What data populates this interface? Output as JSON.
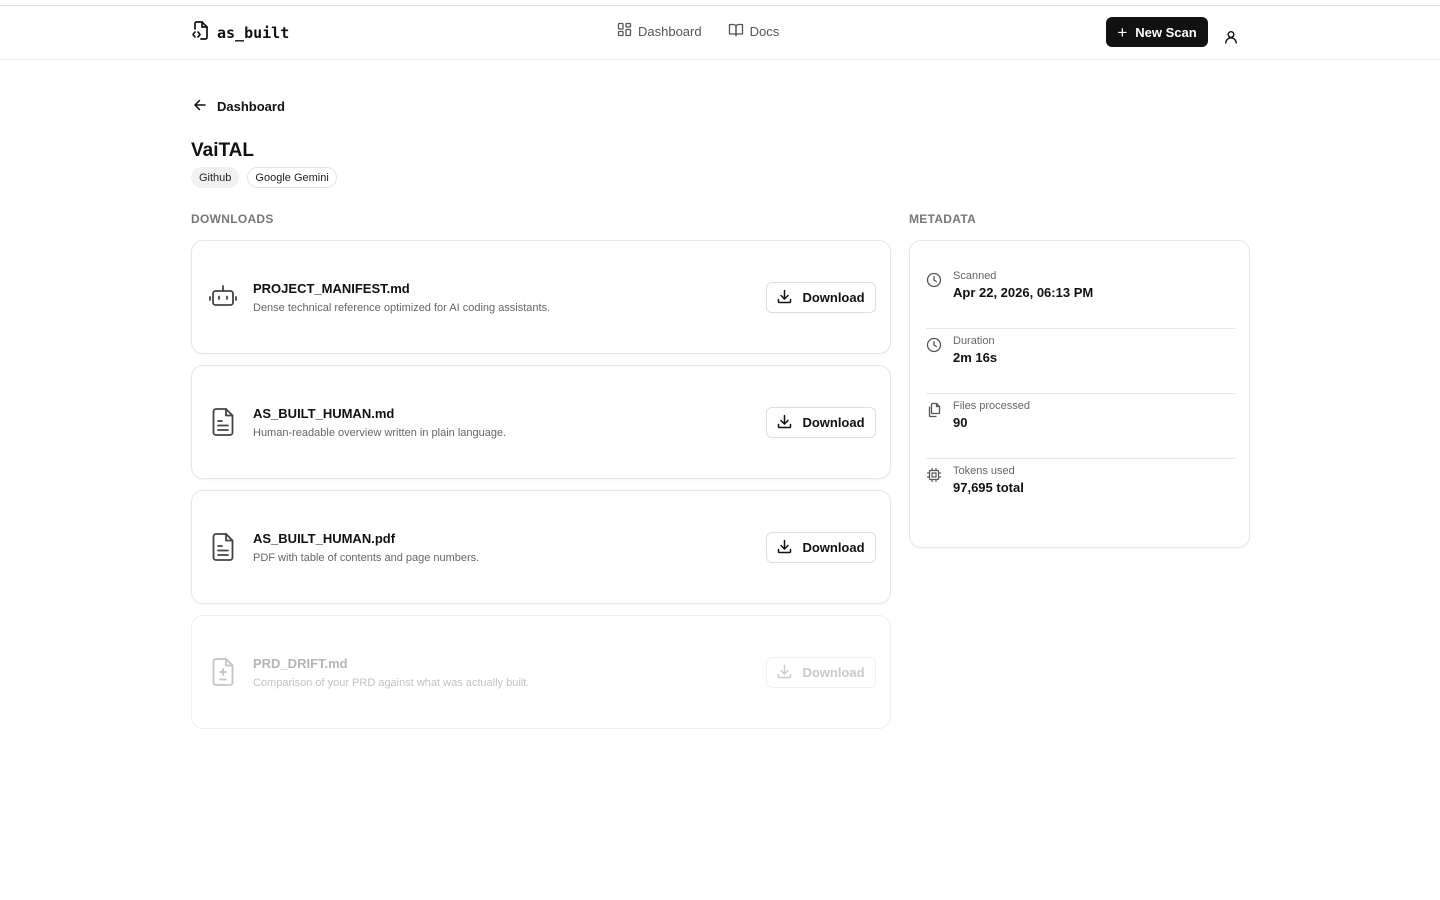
{
  "app": {
    "name": "as_built"
  },
  "nav": {
    "items": [
      {
        "label": "Dashboard",
        "icon": "layout-grid-icon"
      },
      {
        "label": "Docs",
        "icon": "book-open-icon"
      }
    ],
    "new_scan_label": "New Scan"
  },
  "breadcrumb": {
    "back_label": "Dashboard"
  },
  "project": {
    "title": "VaiTAL",
    "tags": [
      "Github",
      "Google Gemini"
    ]
  },
  "downloads": {
    "heading": "DOWNLOADS",
    "items": [
      {
        "name": "PROJECT_MANIFEST.md",
        "description": "Dense technical reference optimized for AI coding assistants.",
        "icon": "bot-icon",
        "button": "Download",
        "enabled": true
      },
      {
        "name": "AS_BUILT_HUMAN.md",
        "description": "Human-readable overview written in plain language.",
        "icon": "file-text-icon",
        "button": "Download",
        "enabled": true
      },
      {
        "name": "AS_BUILT_HUMAN.pdf",
        "description": "PDF with table of contents and page numbers.",
        "icon": "file-text-icon",
        "button": "Download",
        "enabled": true
      },
      {
        "name": "PRD_DRIFT.md",
        "description": "Comparison of your PRD against what was actually built.",
        "icon": "file-diff-icon",
        "button": "Download",
        "enabled": false
      }
    ]
  },
  "metadata": {
    "heading": "METADATA",
    "items": [
      {
        "label": "Scanned",
        "value": "Apr 22, 2026, 06:13 PM",
        "icon": "clock-icon"
      },
      {
        "label": "Duration",
        "value": "2m 16s",
        "icon": "clock-icon"
      },
      {
        "label": "Files processed",
        "value": "90",
        "icon": "files-icon"
      },
      {
        "label": "Tokens used",
        "value": "97,695 total",
        "icon": "cpu-icon"
      }
    ]
  },
  "colors": {
    "primary": "#111111",
    "border": "#e6e6e6",
    "muted_text": "#666666"
  }
}
